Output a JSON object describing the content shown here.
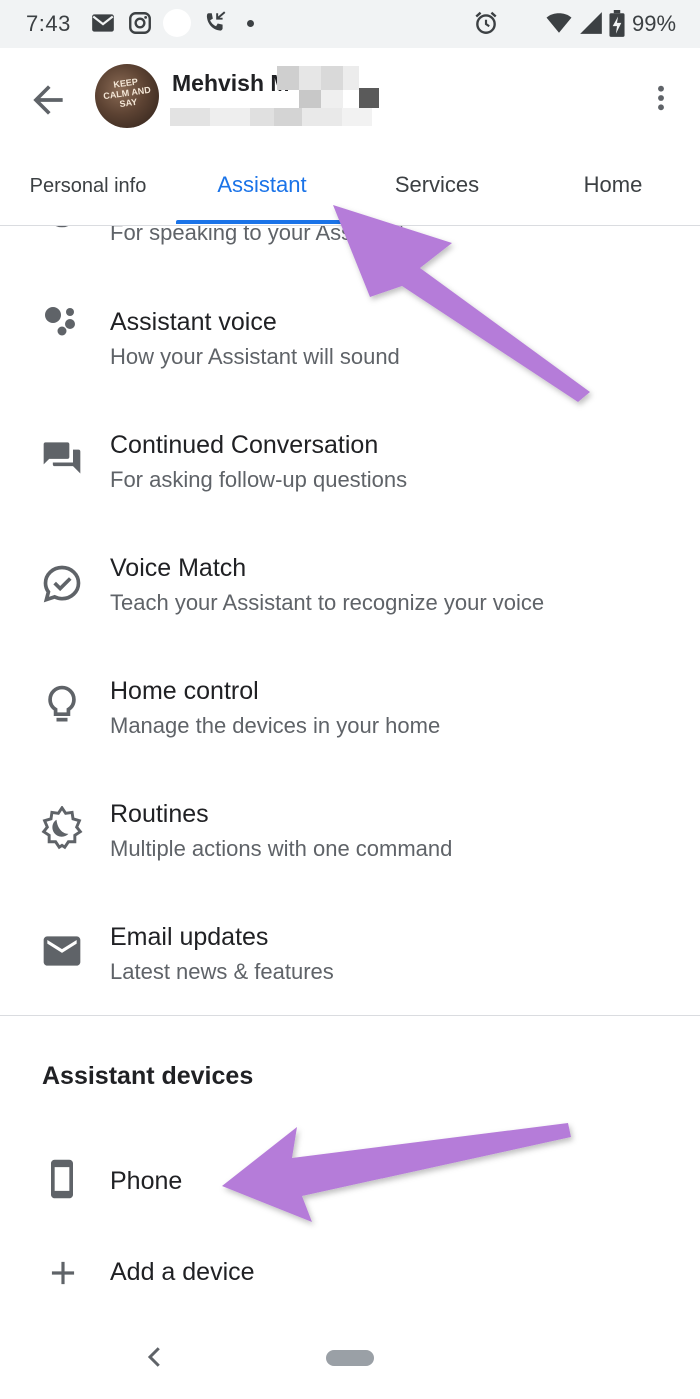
{
  "status_bar": {
    "time": "7:43",
    "battery_percent": "99%",
    "icons": [
      "gmail-icon",
      "instagram-icon",
      "missed-call-icon",
      "alarm-icon",
      "wifi-icon",
      "signal-icon",
      "battery-charging-icon"
    ]
  },
  "header": {
    "account_name": "Mehvish M",
    "avatar_text": "KEEP CALM AND SAY"
  },
  "tabs": [
    {
      "label": "Personal info",
      "active": false
    },
    {
      "label": "Assistant",
      "active": true
    },
    {
      "label": "Services",
      "active": false
    },
    {
      "label": "Home",
      "active": false
    }
  ],
  "settings": {
    "partial_item_subtitle": "For speaking to your Assistant",
    "items": [
      {
        "title": "Assistant voice",
        "subtitle": "How your Assistant will sound",
        "icon": "assistant-dots-icon"
      },
      {
        "title": "Continued Conversation",
        "subtitle": "For asking follow-up questions",
        "icon": "chat-bubbles-icon"
      },
      {
        "title": "Voice Match",
        "subtitle": "Teach your Assistant to recognize your voice",
        "icon": "voice-match-icon"
      },
      {
        "title": "Home control",
        "subtitle": "Manage the devices in your home",
        "icon": "lightbulb-icon"
      },
      {
        "title": "Routines",
        "subtitle": "Multiple actions with one command",
        "icon": "routines-sun-moon-icon"
      },
      {
        "title": "Email updates",
        "subtitle": "Latest news & features",
        "icon": "mail-icon"
      }
    ]
  },
  "devices": {
    "heading": "Assistant devices",
    "items": [
      {
        "label": "Phone",
        "icon": "phone-icon"
      },
      {
        "label": "Add a device",
        "icon": "plus-icon"
      }
    ]
  },
  "colors": {
    "accent": "#1a73e8",
    "annotation_arrow": "#b57bd9",
    "text_primary": "#202124",
    "text_secondary": "#5f6368"
  }
}
